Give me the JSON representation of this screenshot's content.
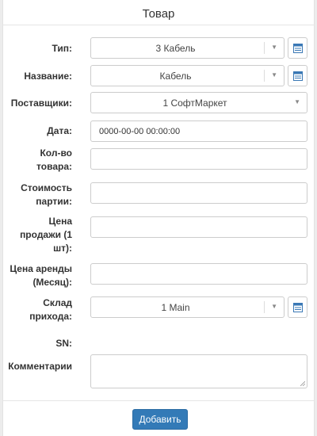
{
  "modal": {
    "title": "Товар"
  },
  "fields": {
    "type": {
      "label": "Тип:",
      "value": "3 Кабель"
    },
    "name": {
      "label": "Название:",
      "value": "Кабель"
    },
    "suppliers": {
      "label": "Поставщики:",
      "value": "1 СофтМаркет"
    },
    "date": {
      "label": "Дата:",
      "value": "0000-00-00 00:00:00"
    },
    "quantity": {
      "label1": "Кол-во",
      "label2": "товара:",
      "value": ""
    },
    "batch_cost": {
      "label1": "Стоимость",
      "label2": "партии:",
      "value": ""
    },
    "sale_price": {
      "label1": "Цена",
      "label2": "продажи (1",
      "label3": "шт):",
      "value": ""
    },
    "rent_price": {
      "label1": "Цена аренды",
      "label2": "(Месяц):",
      "value": ""
    },
    "warehouse": {
      "label1": "Склад",
      "label2": "прихода:",
      "value": "1 Main"
    },
    "sn": {
      "label": "SN:"
    },
    "comments": {
      "label": "Комментарии",
      "value": ""
    }
  },
  "footer": {
    "add_label": "Добавить"
  },
  "colors": {
    "primary": "#337ab7",
    "icon": "#3a78b5"
  },
  "icons": {
    "dropdown": "caret-down-icon",
    "list_button": "list-icon"
  }
}
